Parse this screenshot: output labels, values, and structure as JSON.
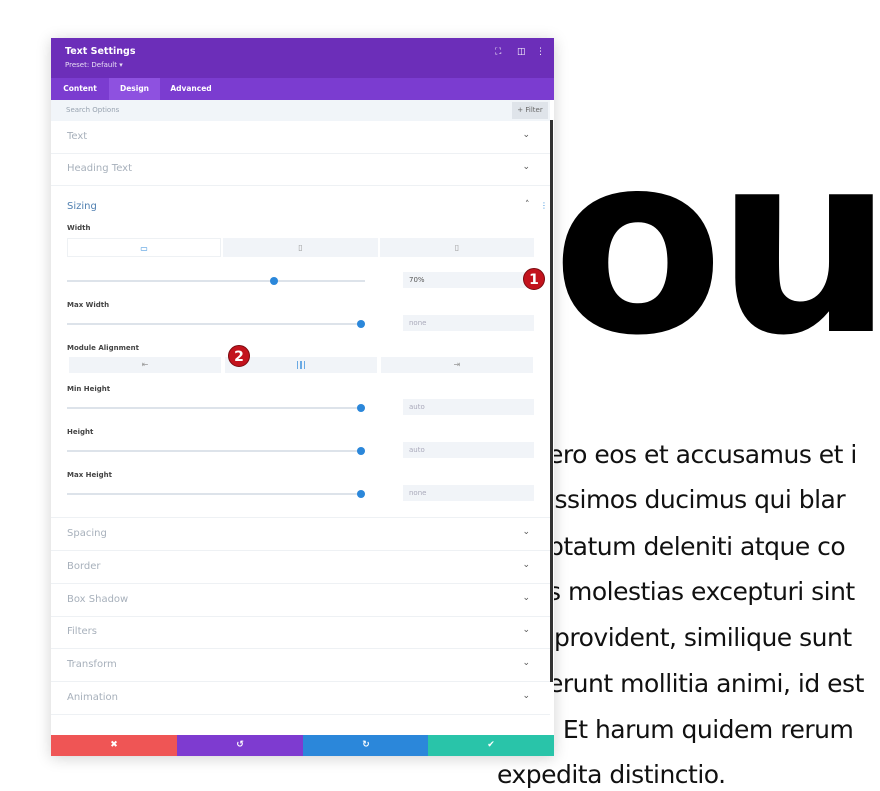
{
  "background": {
    "heading": "ou",
    "lines": [
      "ero eos et accusamus et i",
      "issimos ducimus qui blar",
      "ptatum deleniti atque co",
      "s molestias excepturi sint",
      "provident, similique sunt",
      "erunt mollitia animi, id est",
      ". Et harum quidem rerum",
      "expedita distinctio."
    ]
  },
  "panel": {
    "title": "Text Settings",
    "preset": "Preset: Default ▾",
    "header_icons": [
      "expand-icon",
      "split-view-icon",
      "more-icon"
    ],
    "tabs": [
      "Content",
      "Design",
      "Advanced"
    ],
    "active_tab": "Design",
    "search_placeholder": "Search Options",
    "filter_label": "+ Filter",
    "sections_top": [
      "Text",
      "Heading Text"
    ],
    "sizing": {
      "title": "Sizing",
      "width_label": "Width",
      "width_value": "70%",
      "width_slider": 70,
      "max_width_label": "Max Width",
      "max_width_value": "none",
      "alignment_label": "Module Alignment",
      "alignment_selected": "center",
      "min_height_label": "Min Height",
      "min_height_value": "auto",
      "height_label": "Height",
      "height_value": "auto",
      "max_height_label": "Max Height",
      "max_height_value": "none"
    },
    "sections_bottom": [
      "Spacing",
      "Border",
      "Box Shadow",
      "Filters",
      "Transform",
      "Animation"
    ],
    "footer": {
      "cancel": "✖",
      "undo": "↺",
      "redo": "↻",
      "save": "✔"
    },
    "colors": {
      "header": "#6c2eb9",
      "cancel": "#ef5555",
      "undo": "#7e3bd0",
      "redo": "#2b87da",
      "save": "#29c4a9",
      "accent": "#2b87da"
    }
  },
  "annotations": [
    "1",
    "2"
  ]
}
